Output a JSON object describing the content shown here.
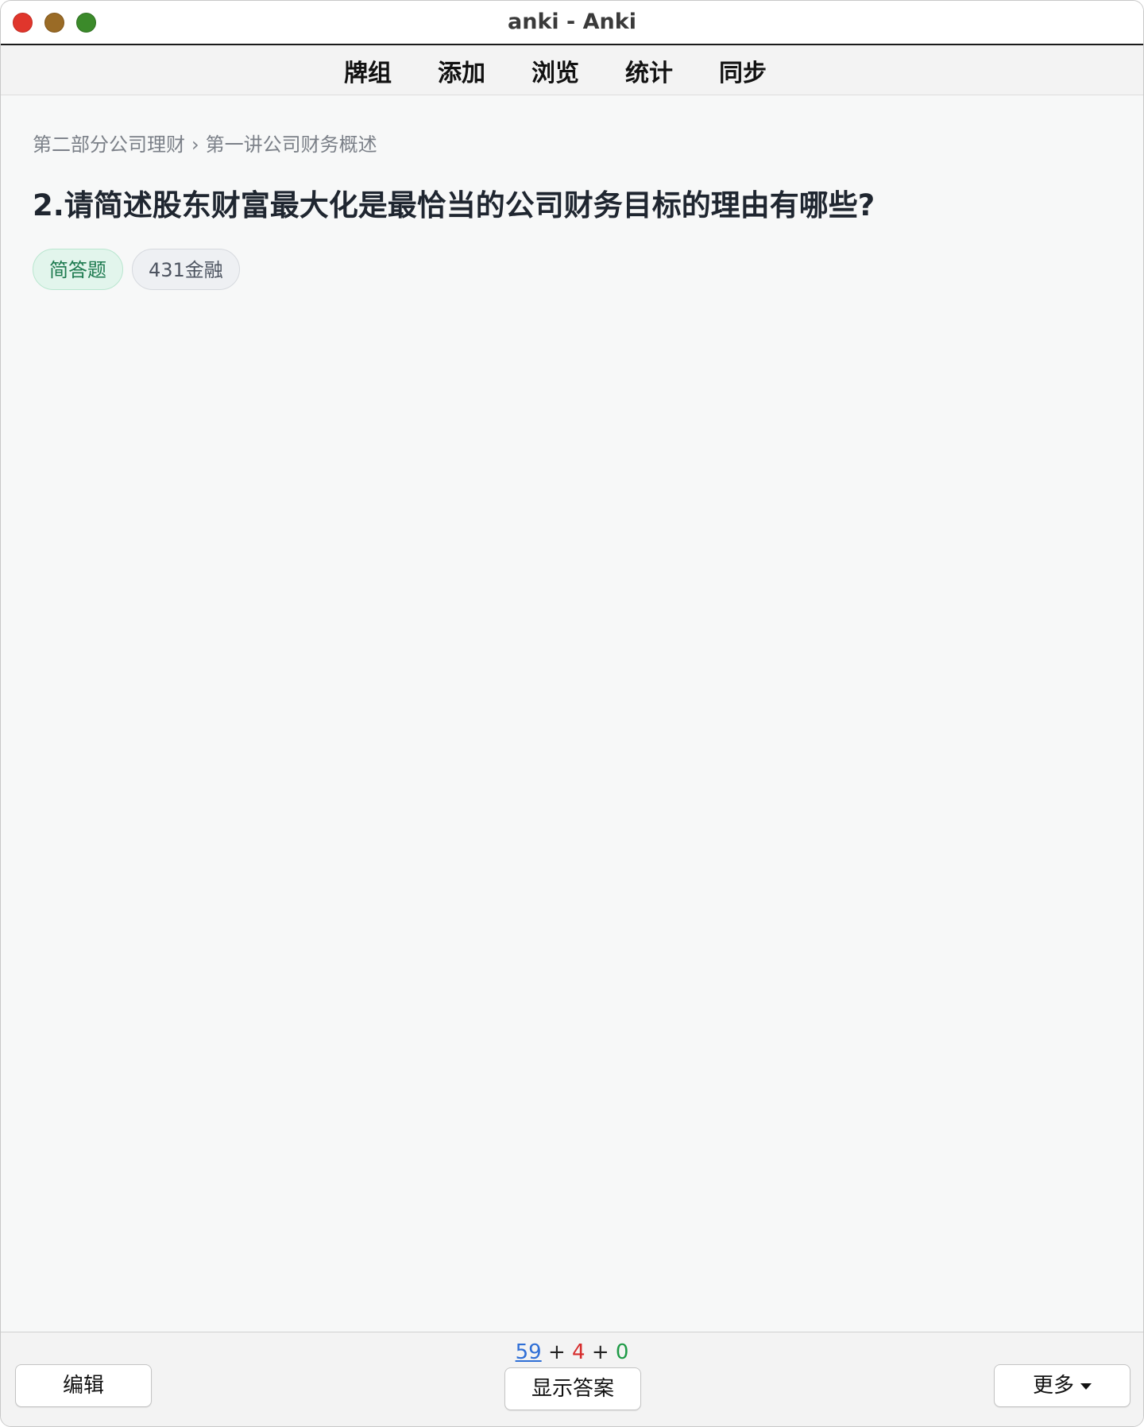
{
  "window": {
    "title": "anki - Anki"
  },
  "toolbar": {
    "items": [
      {
        "label": "牌组"
      },
      {
        "label": "添加"
      },
      {
        "label": "浏览"
      },
      {
        "label": "统计"
      },
      {
        "label": "同步"
      }
    ]
  },
  "card": {
    "breadcrumb": [
      "第二部分公司理财",
      "第一讲公司财务概述"
    ],
    "breadcrumb_separator": "›",
    "question": "2.请简述股东财富最大化是最恰当的公司财务目标的理由有哪些?",
    "tags": [
      {
        "label": "简答题",
        "color": "#1d7a4f"
      },
      {
        "label": "431金融",
        "color": "#4d5460"
      }
    ]
  },
  "bottom": {
    "counts": {
      "new": "59",
      "learn": "4",
      "review": "0",
      "plus": "+"
    },
    "edit_label": "编辑",
    "show_answer_label": "显示答案",
    "more_label": "更多"
  },
  "colors": {
    "count_new": "#2f6fd6",
    "count_learn": "#d62b2b",
    "count_review": "#1e9a46"
  }
}
